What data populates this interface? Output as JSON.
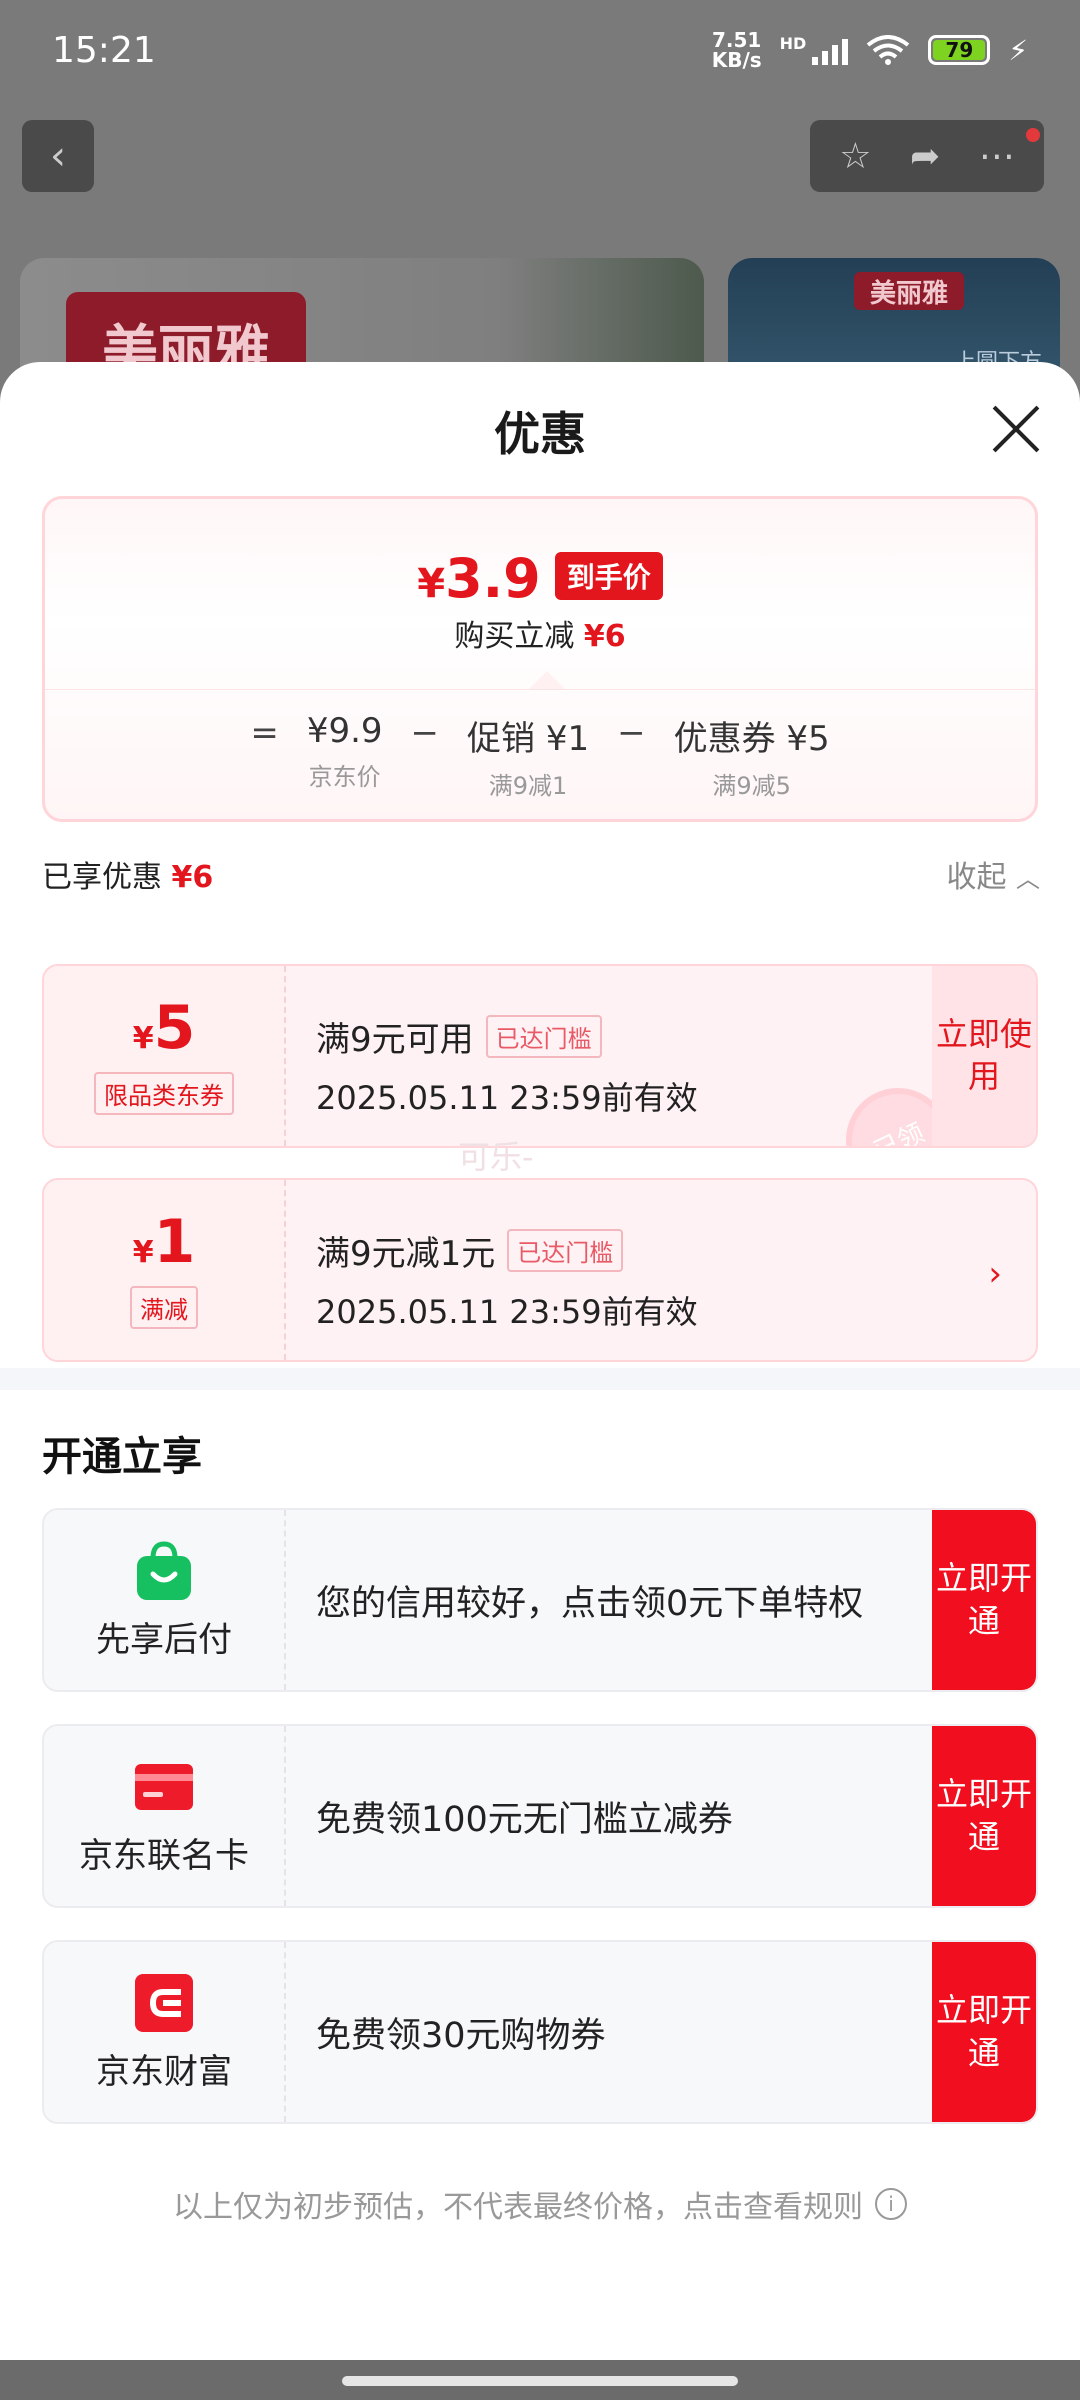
{
  "status_bar": {
    "time": "15:21",
    "net_speed_value": "7.51",
    "net_speed_unit": "KB/s",
    "network_label": "HD",
    "battery": "79"
  },
  "background": {
    "brand_logo": "美丽雅",
    "banner_b_logo": "美丽雅",
    "banner_b_text": "上圆下方"
  },
  "sheet": {
    "title": "优惠",
    "price": {
      "currency": "¥",
      "final_price": "3.9",
      "badge": "到手价",
      "sub_prefix": "购买立减",
      "sub_amount": "¥6",
      "eq": "=",
      "items": [
        {
          "top": "¥9.9",
          "bottom": "京东价"
        },
        {
          "top": "促销 ¥1",
          "bottom": "满9减1"
        },
        {
          "top": "优惠券 ¥5",
          "bottom": "满9减5"
        }
      ],
      "op": "−"
    },
    "enjoyed_label": "已享优惠",
    "enjoyed_amount": "¥6",
    "collapse_label": "收起",
    "coupons": [
      {
        "currency": "¥",
        "amount": "5",
        "tag": "限品类东券",
        "condition": "满9元可用",
        "status": "已达门槛",
        "valid": "2025.05.11 23:59前有效",
        "action": "立即使用",
        "stamp": "已领"
      },
      {
        "currency": "¥",
        "amount": "1",
        "tag": "满减",
        "condition": "满9元减1元",
        "status": "已达门槛",
        "valid": "2025.05.11 23:59前有效"
      }
    ],
    "watermark": "可乐-",
    "open_title": "开通立享",
    "services": [
      {
        "name": "先享后付",
        "icon": "shopping-bag-icon",
        "color": "#16c060",
        "text": "您的信用较好，点击领0元下单特权",
        "action": "立即开通"
      },
      {
        "name": "京东联名卡",
        "icon": "credit-card-icon",
        "color": "#ee1c2b",
        "text": "免费领100元无门槛立减券",
        "action": "立即开通"
      },
      {
        "name": "京东财富",
        "icon": "wealth-icon",
        "color": "#ee1c2b",
        "text": "免费领30元购物券",
        "action": "立即开通"
      }
    ],
    "disclaimer": "以上仅为初步预估，不代表最终价格，点击查看规则"
  },
  "colors": {
    "brand_red": "#e4161d",
    "button_red": "#f10f1f",
    "badge_pink": "#ffd5da"
  }
}
